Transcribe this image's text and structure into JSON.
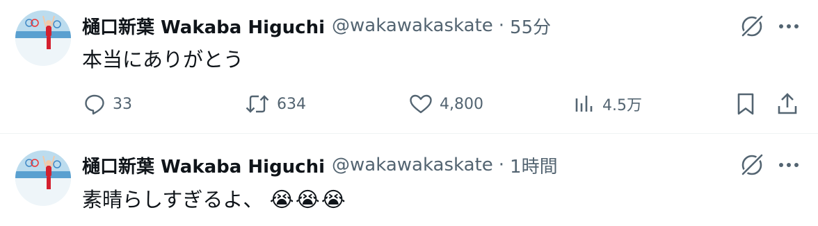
{
  "tweets": [
    {
      "author_name": "樋口新葉 Wakaba Higuchi",
      "handle": "@wakawakaskate",
      "separator": "·",
      "time": "55分",
      "text": "本当にありがとう",
      "reply_count": "33",
      "retweet_count": "634",
      "like_count": "4,800",
      "view_count": "4.5万"
    },
    {
      "author_name": "樋口新葉 Wakaba Higuchi",
      "handle": "@wakawakaskate",
      "separator": "·",
      "time": "1時間",
      "text": "素晴らしすぎるよ、",
      "emoji": "😭😭😭"
    }
  ],
  "colors": {
    "text_primary": "#0f1419",
    "text_secondary": "#536471",
    "divider": "#eff3f4"
  },
  "icons": [
    "grok-icon",
    "more-icon",
    "reply-icon",
    "retweet-icon",
    "like-icon",
    "views-icon",
    "bookmark-icon",
    "share-icon"
  ]
}
